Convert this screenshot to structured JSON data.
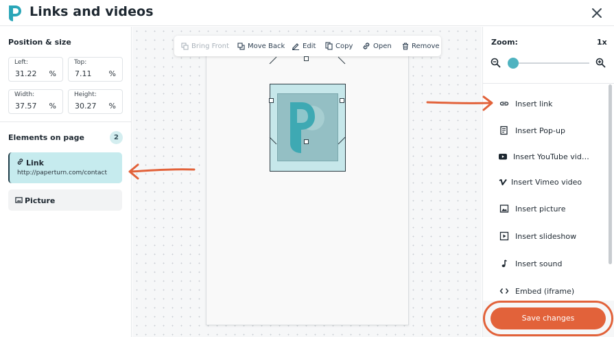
{
  "header": {
    "title": "Links and videos"
  },
  "position_size": {
    "title": "Position & size",
    "fields": {
      "left": {
        "label": "Left:",
        "value": "31.22",
        "unit": "%"
      },
      "top": {
        "label": "Top:",
        "value": "7.11",
        "unit": "%"
      },
      "width": {
        "label": "Width:",
        "value": "37.57",
        "unit": "%"
      },
      "height": {
        "label": "Height:",
        "value": "30.27",
        "unit": "%"
      }
    }
  },
  "elements": {
    "title": "Elements on page",
    "count": "2",
    "items": [
      {
        "name": "Link",
        "url": "http://paperturn.com/contact",
        "icon": "link-icon"
      },
      {
        "name": "Picture",
        "icon": "picture-icon"
      }
    ]
  },
  "toolbar": {
    "bring_front": "Bring Front",
    "move_back": "Move Back",
    "edit": "Edit",
    "copy": "Copy",
    "open": "Open",
    "remove": "Remove"
  },
  "zoom": {
    "label": "Zoom:",
    "value": "1x",
    "level": 0.05
  },
  "insert": {
    "items": [
      {
        "label": "Insert link",
        "icon": "insert-link-icon"
      },
      {
        "label": "Insert Pop-up",
        "icon": "popup-icon"
      },
      {
        "label": "Insert YouTube vid…",
        "icon": "youtube-icon"
      },
      {
        "label": "Insert Vimeo video",
        "icon": "vimeo-icon"
      },
      {
        "label": "Insert picture",
        "icon": "picture-icon"
      },
      {
        "label": "Insert slideshow",
        "icon": "slideshow-icon"
      },
      {
        "label": "Insert sound",
        "icon": "music-note-icon"
      },
      {
        "label": "Embed (iframe)",
        "icon": "code-icon"
      }
    ]
  },
  "save": {
    "label": "Save changes"
  },
  "colors": {
    "accent": "#e2623a",
    "teal": "#4fb3c0",
    "selected_bg": "#c6ebee"
  }
}
